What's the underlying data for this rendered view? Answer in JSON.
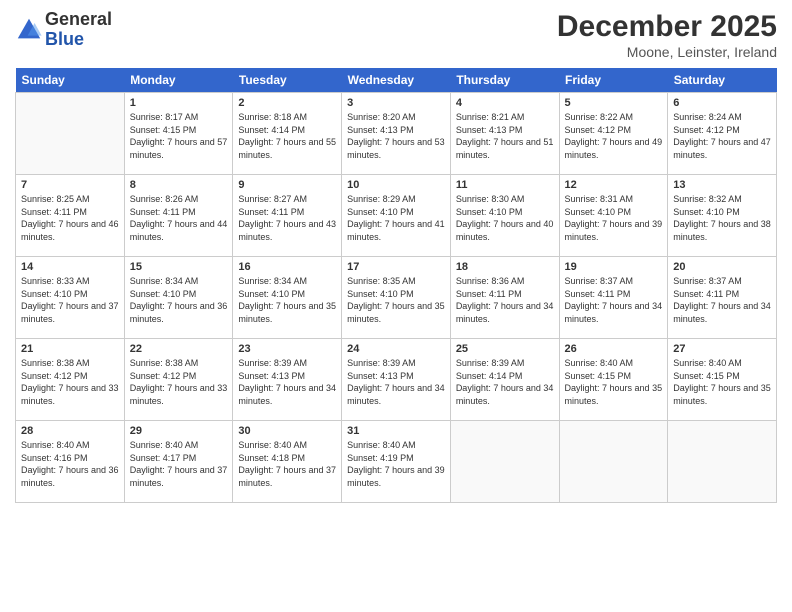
{
  "logo": {
    "general": "General",
    "blue": "Blue"
  },
  "header": {
    "title": "December 2025",
    "location": "Moone, Leinster, Ireland"
  },
  "days_of_week": [
    "Sunday",
    "Monday",
    "Tuesday",
    "Wednesday",
    "Thursday",
    "Friday",
    "Saturday"
  ],
  "weeks": [
    [
      {
        "day": "",
        "sunrise": "",
        "sunset": "",
        "daylight": ""
      },
      {
        "day": "1",
        "sunrise": "Sunrise: 8:17 AM",
        "sunset": "Sunset: 4:15 PM",
        "daylight": "Daylight: 7 hours and 57 minutes."
      },
      {
        "day": "2",
        "sunrise": "Sunrise: 8:18 AM",
        "sunset": "Sunset: 4:14 PM",
        "daylight": "Daylight: 7 hours and 55 minutes."
      },
      {
        "day": "3",
        "sunrise": "Sunrise: 8:20 AM",
        "sunset": "Sunset: 4:13 PM",
        "daylight": "Daylight: 7 hours and 53 minutes."
      },
      {
        "day": "4",
        "sunrise": "Sunrise: 8:21 AM",
        "sunset": "Sunset: 4:13 PM",
        "daylight": "Daylight: 7 hours and 51 minutes."
      },
      {
        "day": "5",
        "sunrise": "Sunrise: 8:22 AM",
        "sunset": "Sunset: 4:12 PM",
        "daylight": "Daylight: 7 hours and 49 minutes."
      },
      {
        "day": "6",
        "sunrise": "Sunrise: 8:24 AM",
        "sunset": "Sunset: 4:12 PM",
        "daylight": "Daylight: 7 hours and 47 minutes."
      }
    ],
    [
      {
        "day": "7",
        "sunrise": "Sunrise: 8:25 AM",
        "sunset": "Sunset: 4:11 PM",
        "daylight": "Daylight: 7 hours and 46 minutes."
      },
      {
        "day": "8",
        "sunrise": "Sunrise: 8:26 AM",
        "sunset": "Sunset: 4:11 PM",
        "daylight": "Daylight: 7 hours and 44 minutes."
      },
      {
        "day": "9",
        "sunrise": "Sunrise: 8:27 AM",
        "sunset": "Sunset: 4:11 PM",
        "daylight": "Daylight: 7 hours and 43 minutes."
      },
      {
        "day": "10",
        "sunrise": "Sunrise: 8:29 AM",
        "sunset": "Sunset: 4:10 PM",
        "daylight": "Daylight: 7 hours and 41 minutes."
      },
      {
        "day": "11",
        "sunrise": "Sunrise: 8:30 AM",
        "sunset": "Sunset: 4:10 PM",
        "daylight": "Daylight: 7 hours and 40 minutes."
      },
      {
        "day": "12",
        "sunrise": "Sunrise: 8:31 AM",
        "sunset": "Sunset: 4:10 PM",
        "daylight": "Daylight: 7 hours and 39 minutes."
      },
      {
        "day": "13",
        "sunrise": "Sunrise: 8:32 AM",
        "sunset": "Sunset: 4:10 PM",
        "daylight": "Daylight: 7 hours and 38 minutes."
      }
    ],
    [
      {
        "day": "14",
        "sunrise": "Sunrise: 8:33 AM",
        "sunset": "Sunset: 4:10 PM",
        "daylight": "Daylight: 7 hours and 37 minutes."
      },
      {
        "day": "15",
        "sunrise": "Sunrise: 8:34 AM",
        "sunset": "Sunset: 4:10 PM",
        "daylight": "Daylight: 7 hours and 36 minutes."
      },
      {
        "day": "16",
        "sunrise": "Sunrise: 8:34 AM",
        "sunset": "Sunset: 4:10 PM",
        "daylight": "Daylight: 7 hours and 35 minutes."
      },
      {
        "day": "17",
        "sunrise": "Sunrise: 8:35 AM",
        "sunset": "Sunset: 4:10 PM",
        "daylight": "Daylight: 7 hours and 35 minutes."
      },
      {
        "day": "18",
        "sunrise": "Sunrise: 8:36 AM",
        "sunset": "Sunset: 4:11 PM",
        "daylight": "Daylight: 7 hours and 34 minutes."
      },
      {
        "day": "19",
        "sunrise": "Sunrise: 8:37 AM",
        "sunset": "Sunset: 4:11 PM",
        "daylight": "Daylight: 7 hours and 34 minutes."
      },
      {
        "day": "20",
        "sunrise": "Sunrise: 8:37 AM",
        "sunset": "Sunset: 4:11 PM",
        "daylight": "Daylight: 7 hours and 34 minutes."
      }
    ],
    [
      {
        "day": "21",
        "sunrise": "Sunrise: 8:38 AM",
        "sunset": "Sunset: 4:12 PM",
        "daylight": "Daylight: 7 hours and 33 minutes."
      },
      {
        "day": "22",
        "sunrise": "Sunrise: 8:38 AM",
        "sunset": "Sunset: 4:12 PM",
        "daylight": "Daylight: 7 hours and 33 minutes."
      },
      {
        "day": "23",
        "sunrise": "Sunrise: 8:39 AM",
        "sunset": "Sunset: 4:13 PM",
        "daylight": "Daylight: 7 hours and 34 minutes."
      },
      {
        "day": "24",
        "sunrise": "Sunrise: 8:39 AM",
        "sunset": "Sunset: 4:13 PM",
        "daylight": "Daylight: 7 hours and 34 minutes."
      },
      {
        "day": "25",
        "sunrise": "Sunrise: 8:39 AM",
        "sunset": "Sunset: 4:14 PM",
        "daylight": "Daylight: 7 hours and 34 minutes."
      },
      {
        "day": "26",
        "sunrise": "Sunrise: 8:40 AM",
        "sunset": "Sunset: 4:15 PM",
        "daylight": "Daylight: 7 hours and 35 minutes."
      },
      {
        "day": "27",
        "sunrise": "Sunrise: 8:40 AM",
        "sunset": "Sunset: 4:15 PM",
        "daylight": "Daylight: 7 hours and 35 minutes."
      }
    ],
    [
      {
        "day": "28",
        "sunrise": "Sunrise: 8:40 AM",
        "sunset": "Sunset: 4:16 PM",
        "daylight": "Daylight: 7 hours and 36 minutes."
      },
      {
        "day": "29",
        "sunrise": "Sunrise: 8:40 AM",
        "sunset": "Sunset: 4:17 PM",
        "daylight": "Daylight: 7 hours and 37 minutes."
      },
      {
        "day": "30",
        "sunrise": "Sunrise: 8:40 AM",
        "sunset": "Sunset: 4:18 PM",
        "daylight": "Daylight: 7 hours and 37 minutes."
      },
      {
        "day": "31",
        "sunrise": "Sunrise: 8:40 AM",
        "sunset": "Sunset: 4:19 PM",
        "daylight": "Daylight: 7 hours and 39 minutes."
      },
      {
        "day": "",
        "sunrise": "",
        "sunset": "",
        "daylight": ""
      },
      {
        "day": "",
        "sunrise": "",
        "sunset": "",
        "daylight": ""
      },
      {
        "day": "",
        "sunrise": "",
        "sunset": "",
        "daylight": ""
      }
    ]
  ]
}
